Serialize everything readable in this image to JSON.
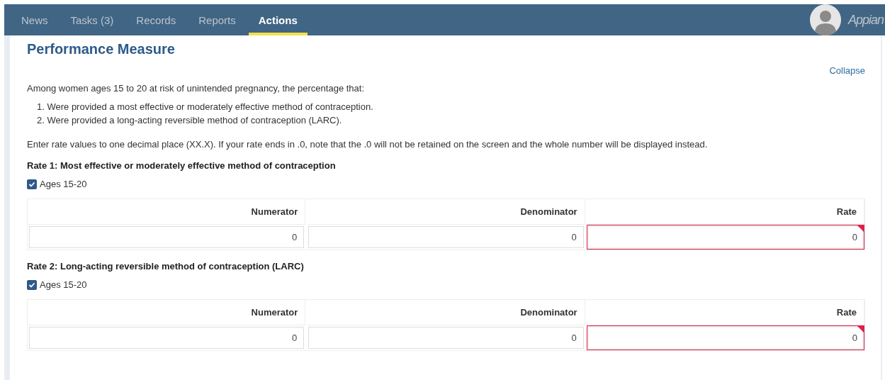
{
  "nav": {
    "tabs": [
      {
        "label": "News",
        "selected": false
      },
      {
        "label": "Tasks (3)",
        "selected": false
      },
      {
        "label": "Records",
        "selected": false
      },
      {
        "label": "Reports",
        "selected": false
      },
      {
        "label": "Actions",
        "selected": true
      }
    ],
    "brand": "Appian"
  },
  "section": {
    "title": "Performance Measure",
    "collapse_link": "Collapse",
    "intro": "Among women ages 15 to 20 at risk of unintended pregnancy, the percentage that:",
    "list": [
      "1. Were provided a most effective or moderately effective method of contraception.",
      "2. Were provided a long-acting reversible method of contraception (LARC)."
    ],
    "note": "Enter rate values to one decimal place (XX.X). If your rate ends in .0, note that the .0 will not be retained on the screen and the whole number will be displayed instead.",
    "rates": [
      {
        "heading": "Rate 1: Most effective or moderately effective method of contraception",
        "checkbox": {
          "label": "Ages 15-20",
          "checked": true
        },
        "fields": [
          {
            "label": "Numerator",
            "value": "0",
            "error": false
          },
          {
            "label": "Denominator",
            "value": "0",
            "error": false
          },
          {
            "label": "Rate",
            "value": "0",
            "error": true
          }
        ]
      },
      {
        "heading": "Rate 2: Long-acting reversible method of contraception (LARC)",
        "checkbox": {
          "label": "Ages 15-20",
          "checked": true
        },
        "fields": [
          {
            "label": "Numerator",
            "value": "0",
            "error": false
          },
          {
            "label": "Denominator",
            "value": "0",
            "error": false
          },
          {
            "label": "Rate",
            "value": "0",
            "error": true
          }
        ]
      }
    ]
  }
}
